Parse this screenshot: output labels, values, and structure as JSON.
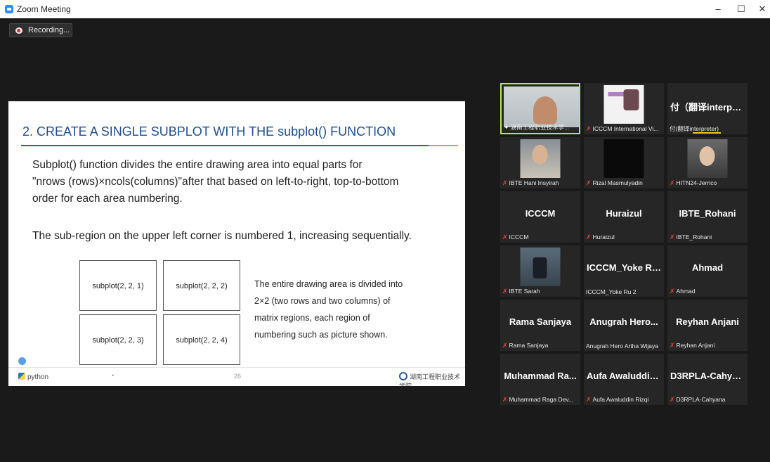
{
  "window": {
    "title": "Zoom Meeting",
    "controls": {
      "minimize": "–",
      "maximize": "☐",
      "close": "✕"
    }
  },
  "recording": {
    "label": "Recording..."
  },
  "slide": {
    "title": "2. CREATE A SINGLE SUBPLOT WITH THE subplot() FUNCTION",
    "para1_line1": "Subplot() function divides the entire drawing area into equal parts for",
    "para1_line2": "\"nrows (rows)×ncols(columns)\"after that based on left-to-right, top-to-bottom",
    "para1_line3": "order for each area numbering.",
    "para2": "The sub-region on the upper left corner is numbered 1, increasing sequentially.",
    "boxes": [
      "subplot(2, 2, 1)",
      "subplot(2, 2, 2)",
      "subplot(2, 2, 3)",
      "subplot(2, 2, 4)"
    ],
    "desc_line1": "The entire drawing area is divided into",
    "desc_line2": "2×2 (two rows and two columns) of",
    "desc_line3": "matrix regions, each region of",
    "desc_line4": "numbering such as picture shown.",
    "python_label": "python",
    "page_number": "26",
    "dot": "•",
    "college_label": "湖南工程职业技术学院"
  },
  "participants": [
    {
      "big": "",
      "tag": "湖南工程职业技术学...",
      "thumb": "video",
      "icon": "pin"
    },
    {
      "big": "",
      "tag": "ICCCM International Vi...",
      "thumb": "poster",
      "icon": "mic"
    },
    {
      "big": "付（翻译interpre...",
      "tag": "付(翻译interpreter)",
      "thumb": "",
      "icon": "none"
    },
    {
      "big": "",
      "tag": "IBTE Hani Insyirah",
      "thumb": "face",
      "icon": "mic"
    },
    {
      "big": "",
      "tag": "Rizal Masmulyadin",
      "thumb": "black",
      "icon": "mic"
    },
    {
      "big": "",
      "tag": "HITN24-Jerrico",
      "thumb": "dark-face",
      "icon": "mic"
    },
    {
      "big": "ICCCM",
      "tag": "ICCCM",
      "thumb": "",
      "icon": "mic"
    },
    {
      "big": "Huraizul",
      "tag": "Huraizul",
      "thumb": "",
      "icon": "mic"
    },
    {
      "big": "IBTE_Rohani",
      "tag": "IBTE_Rohani",
      "thumb": "",
      "icon": "mic"
    },
    {
      "big": "",
      "tag": "IBTE Sarah",
      "thumb": "room",
      "icon": "mic"
    },
    {
      "big": "ICCCM_Yoke Ru 2",
      "tag": "ICCCM_Yoke Ru 2",
      "thumb": "",
      "icon": "none"
    },
    {
      "big": "Ahmad",
      "tag": "Ahmad",
      "thumb": "",
      "icon": "mic"
    },
    {
      "big": "Rama Sanjaya",
      "tag": "Rama Sanjaya",
      "thumb": "",
      "icon": "mic"
    },
    {
      "big": "Anugrah Hero...",
      "tag": "Anugrah Hero Artha Wijaya",
      "thumb": "",
      "icon": "none"
    },
    {
      "big": "Reyhan Anjani",
      "tag": "Reyhan Anjani",
      "thumb": "",
      "icon": "mic"
    },
    {
      "big": "Muhammad  Ra...",
      "tag": "Muhammad Raga Dev...",
      "thumb": "",
      "icon": "mic"
    },
    {
      "big": "Aufa  Awaluddin...",
      "tag": "Aufa Awaluddin Rizqi",
      "thumb": "",
      "icon": "mic"
    },
    {
      "big": "D3RPLA-Cahyana",
      "tag": "D3RPLA-Cahyana",
      "thumb": "",
      "icon": "mic"
    }
  ]
}
